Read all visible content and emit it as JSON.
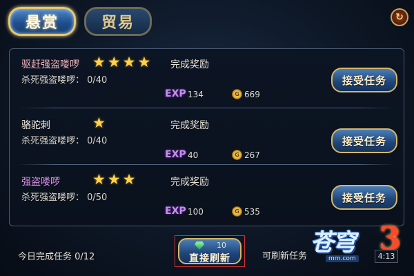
{
  "tabs": {
    "bounty": "悬赏",
    "trade": "贸易"
  },
  "reward_label": "完成奖励",
  "exp_label": "EXP",
  "coin_glyph": "G",
  "accept_label": "接受任务",
  "quests": [
    {
      "name": "驱赶强盗喽啰",
      "stars": 4,
      "progress": "杀死强盗喽啰： 0/40",
      "exp": "134",
      "gold": "669"
    },
    {
      "name": "骆驼刺",
      "stars": 1,
      "progress": "杀死强盗喽啰： 0/40",
      "exp": "40",
      "gold": "267"
    },
    {
      "name": "强盗喽啰",
      "stars": 3,
      "progress": "杀死强盗喽啰： 0/50",
      "exp": "100",
      "gold": "535"
    }
  ],
  "footer": {
    "daily_done": "今日完成任务 0/12",
    "refresh_cost": "10",
    "refresh_label": "直接刷新",
    "free_refresh": "可刷新任务",
    "timer": "4:13"
  },
  "logo": {
    "main": "苍穹",
    "num": "3",
    "sub": "mm.com"
  }
}
